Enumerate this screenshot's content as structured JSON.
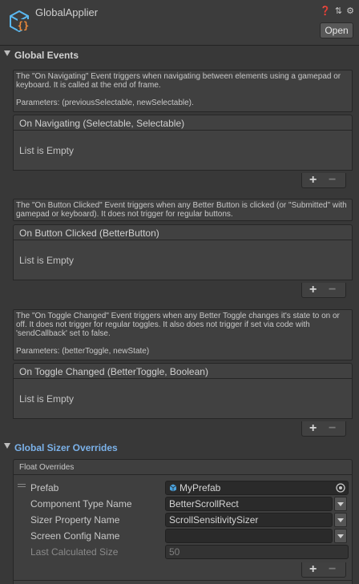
{
  "header": {
    "title": "GlobalApplier",
    "open_button": "Open",
    "icons": [
      "help-icon",
      "presets-icon",
      "settings-icon"
    ]
  },
  "sections": {
    "global_events": "Global Events",
    "global_sizer_overrides": "Global Sizer Overrides"
  },
  "events": [
    {
      "help": "The \"On Navigating\" Event triggers when navigating between elements using a gamepad or keyboard. It is called at the end of frame.",
      "params": "Parameters: (previousSelectable, newSelectable).",
      "title": "On Navigating (Selectable, Selectable)",
      "empty": "List is Empty"
    },
    {
      "help": "The \"On Button Clicked\" Event triggers when any Better Button is clicked (or \"Submitted\" with gamepad or keyboard). It does not trigger for regular buttons.",
      "params": "",
      "title": "On Button Clicked (BetterButton)",
      "empty": "List is Empty"
    },
    {
      "help": "The \"On Toggle Changed\" Event triggers when any Better Toggle changes it's state to on or off. It does not trigger for regular toggles. It also does not trigger if set via code with 'sendCallback' set to false.",
      "params": "Parameters: (betterToggle, newState)",
      "title": "On Toggle Changed (BetterToggle, Boolean)",
      "empty": "List is Empty"
    }
  ],
  "list_controls": {
    "plus": "+",
    "minus": "−"
  },
  "sizer": {
    "subheader": "Float Overrides",
    "rows": [
      {
        "label": "Prefab",
        "value": "MyPrefab"
      },
      {
        "label": "Component Type Name",
        "value": "BetterScrollRect"
      },
      {
        "label": "Sizer Property Name",
        "value": "ScrollSensitivitySizer"
      },
      {
        "label": "Screen Config Name",
        "value": ""
      },
      {
        "label": "Last Calculated Size",
        "value": "50"
      }
    ]
  },
  "colors": {
    "background": "#383838",
    "link_blue": "#7bb2ea",
    "prefab_blue": "#4aa3df",
    "asset_icon_blue": "#5bb8f0",
    "asset_icon_orange": "#f08a3a"
  }
}
